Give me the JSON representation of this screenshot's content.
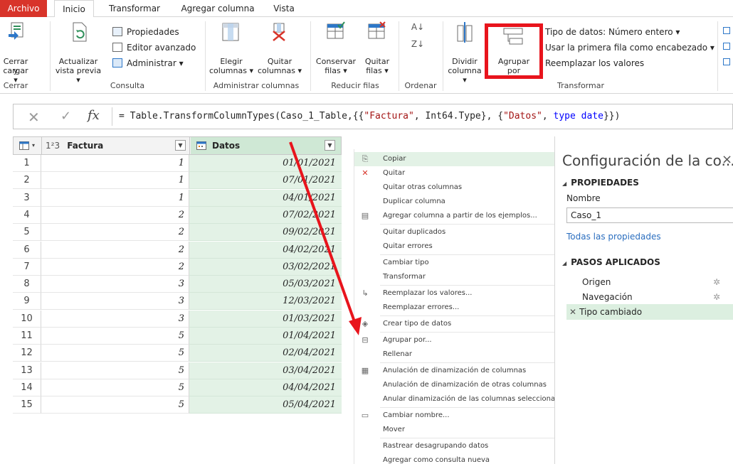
{
  "menu": {
    "tabs": [
      {
        "label": "Archivo"
      },
      {
        "label": "Inicio"
      },
      {
        "label": "Transformar"
      },
      {
        "label": "Agregar columna"
      },
      {
        "label": "Vista"
      }
    ]
  },
  "ribbon": {
    "cerrar": {
      "btn": "Cerrar y",
      "btn2": "cargar ▾",
      "group": "Cerrar"
    },
    "consulta": {
      "actualizar": "Actualizar",
      "actualizar2": "vista previa ▾",
      "propiedades": "Propiedades",
      "editor": "Editor avanzado",
      "administrar": "Administrar ▾",
      "group": "Consulta"
    },
    "columnas": {
      "elegir": "Elegir",
      "elegir2": "columnas ▾",
      "quitar": "Quitar",
      "quitar2": "columnas ▾",
      "group": "Administrar columnas"
    },
    "filas": {
      "conservar": "Conservar",
      "conservar2": "filas ▾",
      "quitar": "Quitar",
      "quitar2": "filas ▾",
      "group": "Reducir filas"
    },
    "ordenar": {
      "group": "Ordenar"
    },
    "transformar": {
      "dividir": "Dividir",
      "dividir2": "columna ▾",
      "agrupar": "Agrupar",
      "agrupar2": "por",
      "tipo": "Tipo de datos: Número entero ▾",
      "primera": "Usar la primera fila como encabezado ▾",
      "reemplazar": "Reemplazar los valores",
      "group": "Transformar"
    }
  },
  "formula": {
    "prefix": "= Table.TransformColumnTypes(Caso_1_Table,{{",
    "s1": "\"Factura\"",
    "mid1": ", Int64.Type}, {",
    "s2": "\"Datos\"",
    "mid2": ", ",
    "kw": "type date",
    "suffix": "}})"
  },
  "grid": {
    "columns": {
      "factura": "Factura",
      "datos": "Datos",
      "factura_type": "1²3"
    },
    "rows": [
      {
        "n": "1",
        "factura": "1",
        "datos": "01/01/2021"
      },
      {
        "n": "2",
        "factura": "1",
        "datos": "07/01/2021"
      },
      {
        "n": "3",
        "factura": "1",
        "datos": "04/01/2021"
      },
      {
        "n": "4",
        "factura": "2",
        "datos": "07/02/2021"
      },
      {
        "n": "5",
        "factura": "2",
        "datos": "09/02/2021"
      },
      {
        "n": "6",
        "factura": "2",
        "datos": "04/02/2021"
      },
      {
        "n": "7",
        "factura": "2",
        "datos": "03/02/2021"
      },
      {
        "n": "8",
        "factura": "3",
        "datos": "05/03/2021"
      },
      {
        "n": "9",
        "factura": "3",
        "datos": "12/03/2021"
      },
      {
        "n": "10",
        "factura": "3",
        "datos": "01/03/2021"
      },
      {
        "n": "11",
        "factura": "5",
        "datos": "01/04/2021"
      },
      {
        "n": "12",
        "factura": "5",
        "datos": "02/04/2021"
      },
      {
        "n": "13",
        "factura": "5",
        "datos": "03/04/2021"
      },
      {
        "n": "14",
        "factura": "5",
        "datos": "04/04/2021"
      },
      {
        "n": "15",
        "factura": "5",
        "datos": "05/04/2021"
      }
    ]
  },
  "context_menu": {
    "items": [
      {
        "label": "Copiar",
        "icon": "copy-icon"
      },
      {
        "label": "Quitar",
        "icon": "remove-icon"
      },
      {
        "label": "Quitar otras columnas",
        "icon": ""
      },
      {
        "label": "Duplicar columna",
        "icon": ""
      },
      {
        "label": "Agregar columna a partir de los ejemplos...",
        "icon": "add-column-icon"
      },
      {
        "label": "Quitar duplicados",
        "icon": ""
      },
      {
        "label": "Quitar errores",
        "icon": ""
      },
      {
        "label": "Cambiar tipo",
        "icon": ""
      },
      {
        "label": "Transformar",
        "icon": ""
      },
      {
        "label": "Reemplazar los valores...",
        "icon": "replace-icon"
      },
      {
        "label": "Reemplazar errores...",
        "icon": ""
      },
      {
        "label": "Crear tipo de datos",
        "icon": "data-type-icon"
      },
      {
        "label": "Agrupar por...",
        "icon": "group-by-icon"
      },
      {
        "label": "Rellenar",
        "icon": ""
      },
      {
        "label": "Anulación de dinamización de columnas",
        "icon": "unpivot-icon"
      },
      {
        "label": "Anulación de dinamización de otras columnas",
        "icon": ""
      },
      {
        "label": "Anular dinamización de las columnas seleccionadas ú",
        "icon": ""
      },
      {
        "label": "Cambiar nombre...",
        "icon": "rename-icon"
      },
      {
        "label": "Mover",
        "icon": ""
      },
      {
        "label": "Rastrear desagrupando datos",
        "icon": ""
      },
      {
        "label": "Agregar como consulta nueva",
        "icon": ""
      }
    ]
  },
  "config": {
    "title": "Configuración de la co...",
    "close": "×",
    "props_section": "PROPIEDADES",
    "name_label": "Nombre",
    "name_value": "Caso_1",
    "all_props": "Todas las propiedades",
    "steps_section": "PASOS APLICADOS",
    "steps": [
      {
        "label": "Origen",
        "gear": true
      },
      {
        "label": "Navegación",
        "gear": true
      },
      {
        "label": "Tipo cambiado",
        "gear": false
      }
    ]
  },
  "colors": {
    "archivo": "#d8342a",
    "highlight": "#e8141c",
    "datos_column": "#e3f2e6",
    "link": "#2a6ebf"
  }
}
